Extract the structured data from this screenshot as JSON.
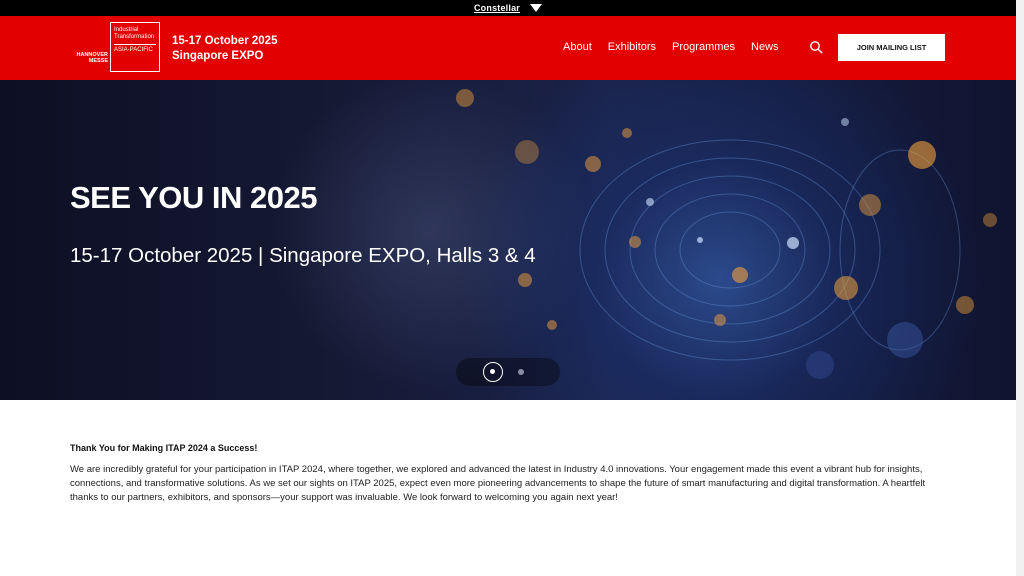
{
  "topbar": {
    "brand": "Constellar"
  },
  "logo": {
    "left_lines": [
      "HANNOVER",
      "MESSE"
    ],
    "box_lines": [
      "Industrial",
      "Transformation"
    ],
    "box_sub": "ASIA-PACIFIC"
  },
  "header": {
    "date_line": "15-17 October 2025",
    "venue_line": "Singapore EXPO"
  },
  "nav": {
    "items": [
      "About",
      "Exhibitors",
      "Programmes",
      "News"
    ]
  },
  "cta": {
    "label": "JOIN MAILING LIST"
  },
  "hero": {
    "title": "SEE YOU IN 2025",
    "subtitle": "15-17 October 2025 | Singapore EXPO, Halls 3 & 4",
    "slides_total": 2,
    "active_slide": 1
  },
  "content": {
    "heading": "Thank You for Making ITAP 2024 a Success!",
    "body": "We are incredibly grateful for your participation in ITAP 2024, where together, we explored and advanced the latest in Industry 4.0 innovations. Your engagement made this event a vibrant hub for insights, connections, and transformative solutions. As we set our sights on ITAP 2025, expect even more pioneering advancements to shape the future of smart manufacturing and digital transformation. A heartfelt thanks to our partners, exhibitors, and sponsors—your support was invaluable. We look forward to welcoming you again next year!"
  },
  "colors": {
    "brand_red": "#e20000",
    "topbar": "#000000"
  }
}
